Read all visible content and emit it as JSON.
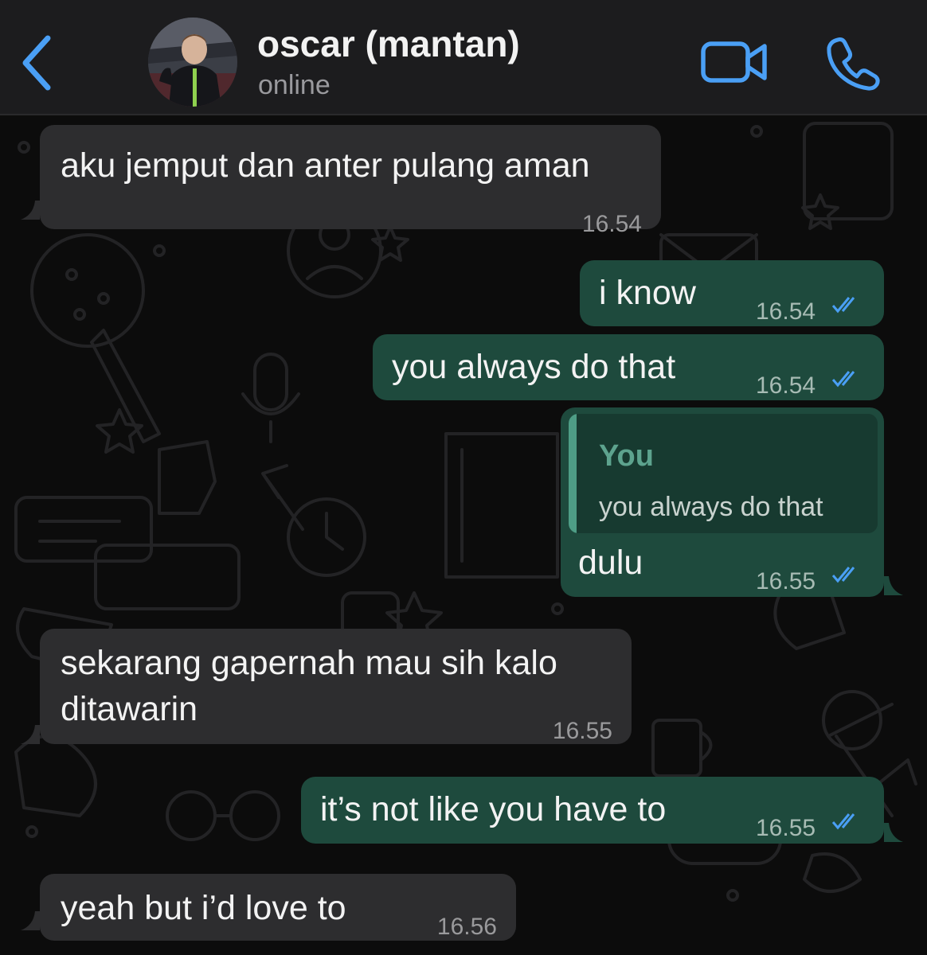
{
  "header": {
    "contact_name": "oscar (mantan)",
    "status": "online",
    "accent_color": "#4a9ff5"
  },
  "messages": [
    {
      "direction": "incoming",
      "text_lines": [
        "aku jemput dan anter pulang aman"
      ],
      "time": "16.54"
    },
    {
      "direction": "outgoing",
      "text_lines": [
        "i know"
      ],
      "time": "16.54",
      "read": true
    },
    {
      "direction": "outgoing",
      "text_lines": [
        "you always do that"
      ],
      "time": "16.54",
      "read": true
    },
    {
      "direction": "outgoing",
      "reply_to": {
        "author": "You",
        "text": "you always do that"
      },
      "text_lines": [
        "dulu"
      ],
      "time": "16.55",
      "read": true
    },
    {
      "direction": "incoming",
      "text_lines": [
        "sekarang gapernah mau sih kalo",
        "ditawarin"
      ],
      "time": "16.55"
    },
    {
      "direction": "outgoing",
      "text_lines": [
        "it’s not like you have to"
      ],
      "time": "16.55",
      "read": true
    },
    {
      "direction": "incoming",
      "text_lines": [
        "yeah but i’d love to"
      ],
      "time": "16.56"
    }
  ],
  "colors": {
    "incoming_bubble": "#2d2d2f",
    "outgoing_bubble": "#1e4a3d",
    "read_ticks": "#4a9ff5",
    "header_bg": "#1c1c1e"
  },
  "icons": [
    "chevron-left-icon",
    "video-camera-icon",
    "phone-icon",
    "double-check-icon"
  ]
}
